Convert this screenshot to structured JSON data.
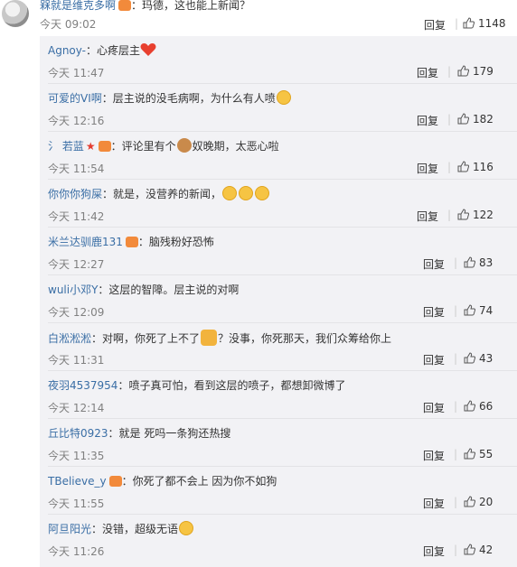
{
  "top": {
    "name": "槑就是维克多啊",
    "text": "：玛德，这也能上新闻？",
    "time": "今天 09:02",
    "reply": "回复",
    "likes": "1148"
  },
  "replies": [
    {
      "name": "Agnoy-",
      "text": "：心疼层主",
      "time": "今天 11:47",
      "likes": "179"
    },
    {
      "name": "可爱的VI啊",
      "text": "：层主说的没毛病啊，为什么有人喷",
      "time": "今天 12:16",
      "likes": "182"
    },
    {
      "name": "若蓝",
      "text_a": "：评论里有个",
      "text_b": "奴晚期，太恶心啦",
      "time": "今天 11:54",
      "likes": "116"
    },
    {
      "name": "你你你狗屎",
      "text": "：就是，没营养的新闻，",
      "time": "今天 11:42",
      "likes": "122"
    },
    {
      "name": "米兰达驯鹿131",
      "text": "：脑残粉好恐怖",
      "time": "今天 12:27",
      "likes": "83"
    },
    {
      "name": "wuli小邓Y",
      "text": "：这层的智障。层主说的对啊",
      "time": "今天 12:09",
      "likes": "74"
    },
    {
      "name": "白淞淞淞",
      "text_a": "：对啊，你死了上不了",
      "text_b": "？没事，你死那天，我们众筹给你上",
      "time": "今天 11:31",
      "likes": "43"
    },
    {
      "name": "夜羽4537954",
      "text": "：喷子真可怕，看到这层的喷子，都想卸微博了",
      "time": "今天 12:14",
      "likes": "66"
    },
    {
      "name": "丘比特0923",
      "text": "：就是 死吗一条狗还热搜",
      "time": "今天 11:35",
      "likes": "55"
    },
    {
      "name": "TBelieve_y",
      "text": "：你死了都不会上 因为你不如狗",
      "time": "今天 11:55",
      "likes": "20"
    },
    {
      "name": "阿旦阳光",
      "text": "：没错，超级无语",
      "time": "今天 11:26",
      "likes": "42"
    }
  ],
  "reply_label": "回复",
  "colors": {
    "name": "#3a6ea5",
    "background": "#f2f2f5",
    "time": "#808080"
  }
}
